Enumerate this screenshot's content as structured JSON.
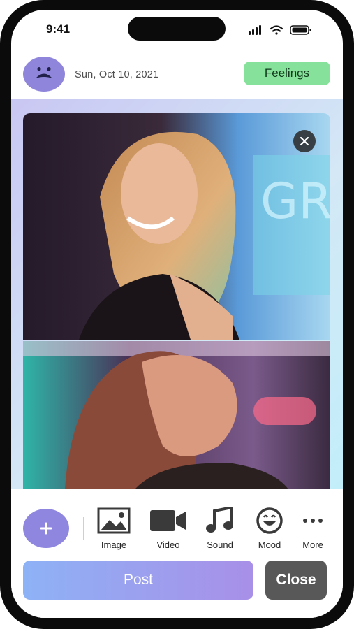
{
  "status_bar": {
    "time": "9:41",
    "icons": [
      "signal-icon",
      "wifi-icon",
      "battery-icon"
    ]
  },
  "header": {
    "avatar_icon": "face-avatar-icon",
    "date": "Sun, Oct 10, 2021",
    "feelings_label": "Feelings"
  },
  "content": {
    "photos": [
      "photo-woman-smiling-neon",
      "photo-woman-eyes-closed-neon"
    ],
    "remove_icon": "close-icon"
  },
  "toolbar": {
    "add_icon": "plus-icon",
    "tools": [
      {
        "label": "Image",
        "icon": "image-icon"
      },
      {
        "label": "Video",
        "icon": "video-camera-icon"
      },
      {
        "label": "Sound",
        "icon": "music-note-icon"
      },
      {
        "label": "Mood",
        "icon": "smile-icon"
      },
      {
        "label": "More",
        "icon": "more-dots-icon"
      }
    ],
    "post_label": "Post",
    "close_label": "Close"
  },
  "colors": {
    "accent_purple": "#8f86e0",
    "feelings_green": "#86e29b",
    "close_gray": "#585858",
    "post_gradient_start": "#8eb2f6",
    "post_gradient_end": "#a88fe8"
  }
}
